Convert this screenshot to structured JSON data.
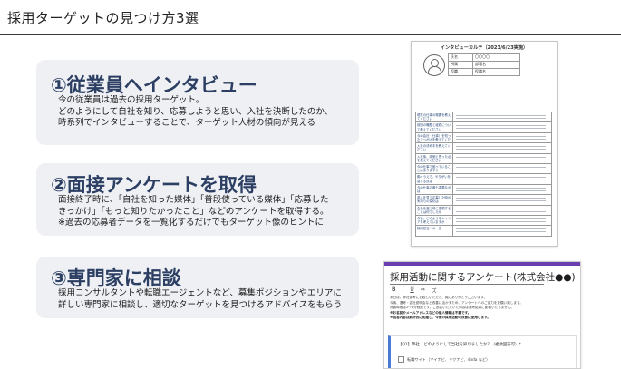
{
  "page": {
    "title": "採用ターゲットの見つけ方3選"
  },
  "cards": [
    {
      "heading": "①従業員へインタビュー",
      "lines": [
        "今の従業員は過去の採用ターゲット。",
        "どのようにして自社を知り、応募しようと思い、入社を決断したのか、",
        "時系列でインタビューすることで、ターゲット人材の傾向が見える"
      ]
    },
    {
      "heading": "②面接アンケートを取得",
      "lines": [
        "面接終了時に、「自社を知った媒体」「普段使っている媒体」「応募した",
        "きっかけ」「もっと知りたかったこと」などのアンケートを取得する。",
        "※過去の応募者データを一覧化するだけでもターゲット像のヒントに"
      ]
    },
    {
      "heading": "③専門家に相談",
      "lines": [
        "採用コンサルタントや転職エージェントなど、募集ポジションやエリアに",
        "詳しい専門家に相談し、適切なターゲットを見つけるアドバイスをもらう"
      ]
    }
  ],
  "karte": {
    "title": "インタビューカルテ（2023/6/23実施）",
    "info": [
      {
        "key": "氏名",
        "value": "〇〇〇〇"
      },
      {
        "key": "所属",
        "value": "部署名"
      },
      {
        "key": "役職",
        "value": "役職名"
      }
    ],
    "questions": [
      "現在の仕事の概要を教えてください",
      "前回の職歴と経緯について教えてください",
      "今の会社（仕事）を知ったきっかけを教えてください",
      "入社の決め手を教えてください",
      "入社後、評価と思った点を教えてください",
      "今の仕事で困っていることはありますか",
      "働くうえで、やりがいを感じる点は",
      "今の仕事の最も重要な点は",
      "求人を見て応募した時の気持ちの変化は",
      "会社を選ぶ時に重視することは何でしたか",
      "今後、どのようなキャリアを考えていますか",
      "採用担当への一言"
    ]
  },
  "survey": {
    "title": "採用活動に関するアンケート(株式会社●●)",
    "format": [
      "B",
      "I",
      "U",
      "⇔",
      "ズ"
    ],
    "description": [
      "本日は、弊社選考にお越しいただき、誠にありがとうございます。",
      "今後、選考・会社説明会など改善に活かすため、アンケートへのご協力をお願い致します。",
      "所要時間は2〜3分程度です。ご回答いただいた内容は選考結果に影響いたしません。"
    ],
    "description_bold": [
      "※お名前やメールアドレスなどの個人情報は不要です。",
      "※回答内容は統計的に処理し、今後の採用活動の改善に使用します。"
    ],
    "question": "【Q1】弊社、どのようにして当社を知りましたか？（複数回答可）*",
    "option": "転職サイト（マイナビ、リクナビ、doda など）"
  }
}
